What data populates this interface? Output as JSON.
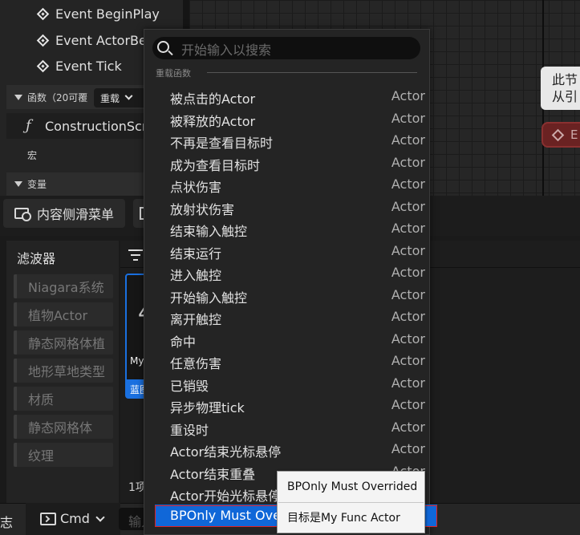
{
  "my_blueprint": {
    "events": [
      {
        "label": "Event BeginPlay"
      },
      {
        "label": "Event ActorBe"
      },
      {
        "label": "Event Tick"
      }
    ],
    "functions_header": "函数（20可覆",
    "override_button": "重载",
    "construction_script": "ConstructionScr",
    "macros_header": "宏",
    "variables_header": "变量"
  },
  "graph": {
    "comment_node_text": [
      "此节",
      "从引"
    ],
    "event_node_label": "E"
  },
  "toolbar": {
    "content_drawer": "内容侧滑菜单"
  },
  "content_browser": {
    "filters_title": "滤波器",
    "filters": [
      "Niagara系统",
      "植物Actor",
      "静态网格体植",
      "地形草地类型",
      "材质",
      "静态网格体",
      "纹理"
    ],
    "asset": {
      "name": "My",
      "type": "蓝图"
    },
    "item_count": "1项"
  },
  "status_bar": {
    "log_fragment": "志",
    "cmd_label": "Cmd",
    "console_placeholder": "输入"
  },
  "override_menu": {
    "search_placeholder": "开始输入以搜索",
    "category": "重载函数",
    "items": [
      {
        "name": "被点击的Actor",
        "class": "Actor"
      },
      {
        "name": "被释放的Actor",
        "class": "Actor"
      },
      {
        "name": "不再是查看目标时",
        "class": "Actor"
      },
      {
        "name": "成为查看目标时",
        "class": "Actor"
      },
      {
        "name": "点状伤害",
        "class": "Actor"
      },
      {
        "name": "放射状伤害",
        "class": "Actor"
      },
      {
        "name": "结束输入触控",
        "class": "Actor"
      },
      {
        "name": "结束运行",
        "class": "Actor"
      },
      {
        "name": "进入触控",
        "class": "Actor"
      },
      {
        "name": "开始输入触控",
        "class": "Actor"
      },
      {
        "name": "离开触控",
        "class": "Actor"
      },
      {
        "name": "命中",
        "class": "Actor"
      },
      {
        "name": "任意伤害",
        "class": "Actor"
      },
      {
        "name": "已销毁",
        "class": "Actor"
      },
      {
        "name": "异步物理tick",
        "class": "Actor"
      },
      {
        "name": "重设时",
        "class": "Actor"
      },
      {
        "name": "Actor结束光标悬停",
        "class": "Actor"
      },
      {
        "name": "Actor结束重叠",
        "class": "Actor"
      },
      {
        "name": "Actor开始光标悬停",
        "class": "Actor"
      },
      {
        "name": "BPOnly Must Overrided",
        "class": "",
        "selected": true
      }
    ]
  },
  "tooltip": {
    "title": "BPOnly Must Overrided",
    "body": "目标是My Func Actor"
  },
  "colors": {
    "selection": "#1067d8",
    "highlight_outline": "#e02020",
    "event_node": "#6a2222"
  }
}
